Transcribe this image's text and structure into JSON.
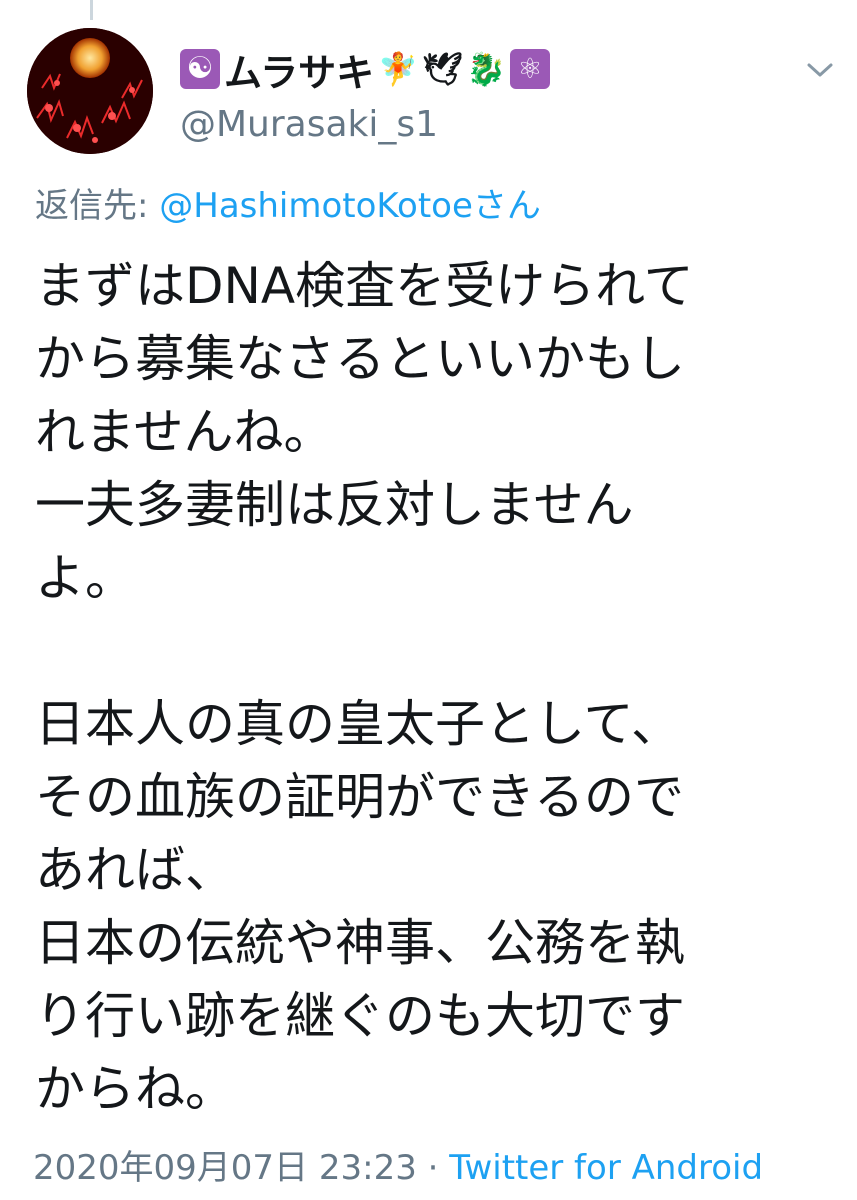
{
  "tweet": {
    "display_name": "ムラサキ",
    "name_emojis_before": [
      "☯"
    ],
    "name_emojis_after": [
      "🧚",
      "🕊",
      "🐉",
      "⚛"
    ],
    "handle": "@Murasaki_s1",
    "reply_prefix": "返信先: ",
    "reply_target": "@HashimotoKotoeさん",
    "body_lines": [
      "まずはDNA検査を受けられて",
      "から募集なさるといいかもし",
      "れませんね。",
      "一夫多妻制は反対しません",
      "よ。",
      "",
      "日本人の真の皇太子として、",
      "その血族の証明ができるので",
      "あれば、",
      "日本の伝統や神事、公務を執",
      "り行い跡を継ぐのも大切です",
      "からね。"
    ],
    "timestamp": "2020年09月07日 23:23",
    "separator": " · ",
    "source": "Twitter for Android"
  },
  "icons": {
    "avatar": "avatar-image",
    "menu": "chevron-down-icon"
  },
  "colors": {
    "text": "#14171a",
    "secondary": "#657786",
    "link": "#1da1f2",
    "badge_purple": "#9b59b6"
  }
}
